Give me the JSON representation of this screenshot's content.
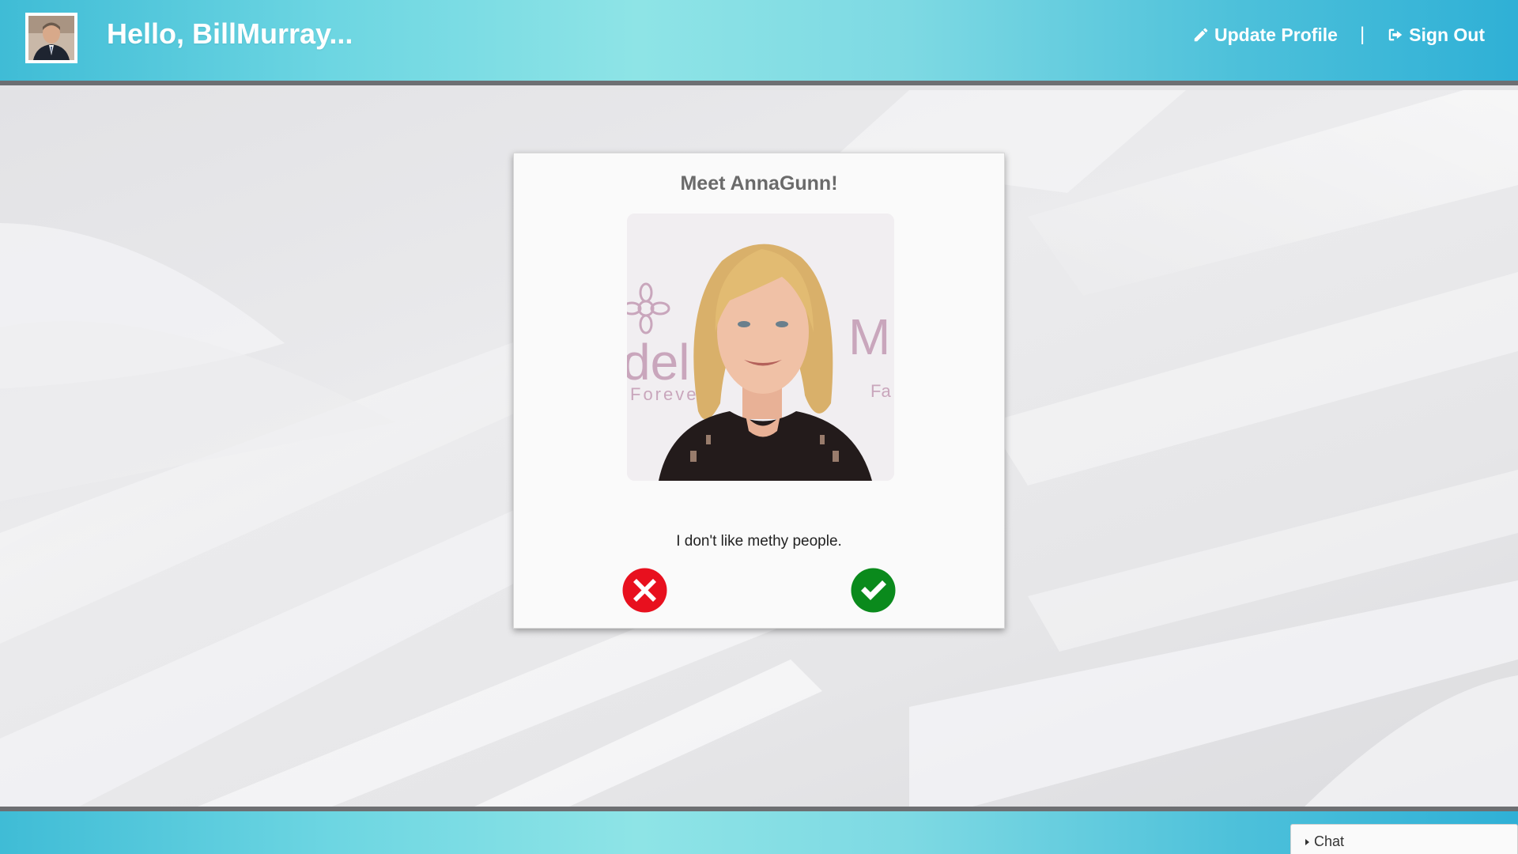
{
  "header": {
    "greeting": "Hello, BillMurray...",
    "avatar_icon": "user-avatar",
    "nav": {
      "update_profile": "Update Profile",
      "update_profile_icon": "pencil-icon",
      "separator": "|",
      "sign_out": "Sign Out",
      "sign_out_icon": "sign-out-icon"
    }
  },
  "card": {
    "title": "Meet AnnaGunn!",
    "photo_text_left": "del",
    "photo_text_left_sub": "Forever",
    "photo_text_right": "M",
    "photo_text_right_sub": "Fa",
    "bio": "I don't like methy people.",
    "reject_icon": "x-circle-icon",
    "accept_icon": "check-circle-icon",
    "reject_color": "#e8101e",
    "accept_color": "#0a8a1c"
  },
  "footer": {
    "chat_label": "Chat"
  },
  "colors": {
    "header_gradient": [
      "#3fbcd6",
      "#8ee4e6",
      "#2fb0d6"
    ],
    "border_bar": "#6d6f72"
  }
}
